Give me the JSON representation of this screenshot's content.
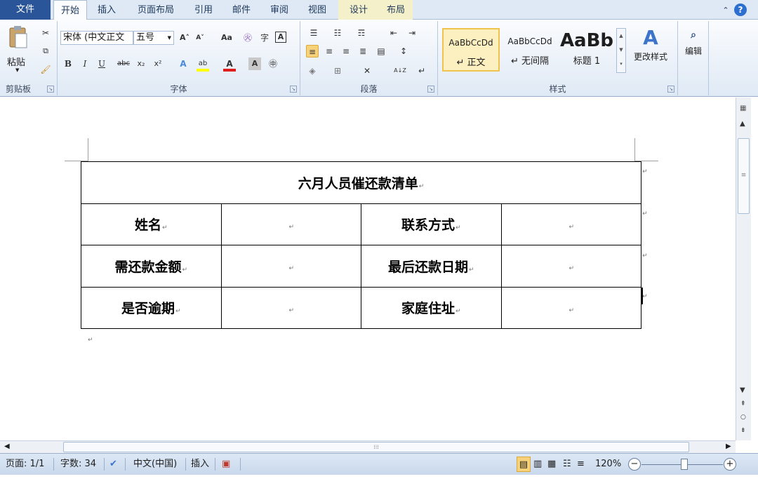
{
  "tabs": {
    "file": "文件",
    "home": "开始",
    "insert": "插入",
    "page_layout": "页面布局",
    "references": "引用",
    "mailings": "邮件",
    "review": "审阅",
    "view": "视图",
    "design": "设计",
    "layout": "布局"
  },
  "ribbon": {
    "clipboard": {
      "label": "剪贴板",
      "paste": "粘贴"
    },
    "font": {
      "label": "字体",
      "font_name": "宋体 (中文正文",
      "font_size": "五号",
      "bold": "B",
      "italic": "I",
      "underline": "U",
      "strike": "abc",
      "subscript": "x₂",
      "superscript": "x²",
      "grow": "A˄",
      "shrink": "A˅",
      "change_case": "Aa",
      "clear": "A"
    },
    "paragraph": {
      "label": "段落",
      "sort": "A↓Z",
      "marks": "↵"
    },
    "styles": {
      "label": "样式",
      "items": [
        {
          "preview": "AaBbCcDd",
          "name": "↵ 正文"
        },
        {
          "preview": "AaBbCcDd",
          "name": "↵ 无间隔"
        },
        {
          "preview": "AaBb",
          "name": "标题 1"
        }
      ],
      "change_styles": "更改样式"
    },
    "editing": {
      "label": "编辑"
    }
  },
  "document": {
    "table": {
      "title": "六月人员催还款清单",
      "rows": [
        [
          "姓名",
          "",
          "联系方式",
          ""
        ],
        [
          "需还款金额",
          "",
          "最后还款日期",
          ""
        ],
        [
          "是否逾期",
          "",
          "家庭住址",
          ""
        ]
      ]
    },
    "para_mark": "↵"
  },
  "statusbar": {
    "page": "页面: 1/1",
    "words": "字数: 34",
    "language": "中文(中国)",
    "mode": "插入",
    "zoom": "120%"
  },
  "colors": {
    "file_tab": "#2a5699",
    "accent": "#f0c34c",
    "ribbon_bg": "#dfe9f5"
  },
  "icons": [
    "clipboard-icon",
    "cut-icon",
    "copy-icon",
    "format-painter-icon",
    "bullets-icon",
    "numbering-icon",
    "multilevel-list-icon",
    "align-left-icon",
    "find-icon",
    "change-styles-icon",
    "proofing-icon",
    "macro-icon",
    "zoom-out-icon",
    "zoom-in-icon",
    "help-icon"
  ]
}
